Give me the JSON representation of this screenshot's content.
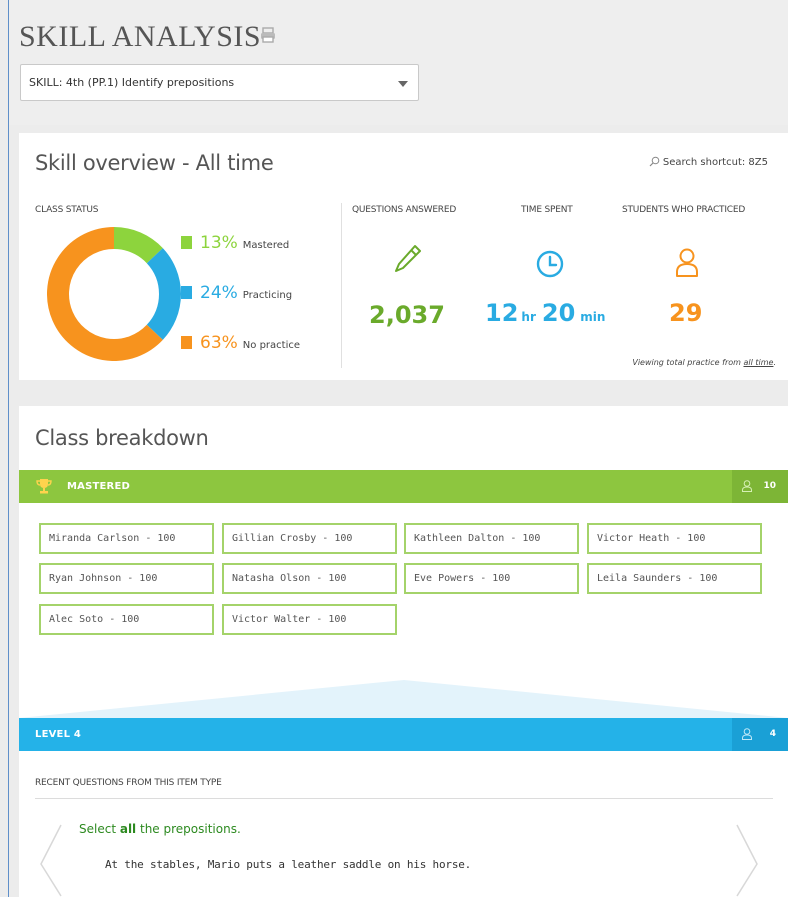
{
  "header": {
    "title": "SKILL ANALYSIS",
    "print_icon": "printer-icon",
    "skill_select_value": "SKILL: 4th (PP.1)  Identify prepositions"
  },
  "overview": {
    "title": "Skill overview - All time",
    "search_shortcut": "Search shortcut: 8Z5",
    "class_status_label": "CLASS STATUS",
    "status": [
      {
        "pct": "13%",
        "label": "Mastered",
        "value": 13,
        "color": "#8dd43d"
      },
      {
        "pct": "24%",
        "label": "Practicing",
        "value": 24,
        "color": "#29abe2"
      },
      {
        "pct": "63%",
        "label": "No practice",
        "value": 63,
        "color": "#f7931e"
      }
    ],
    "questions_label": "QUESTIONS ANSWERED",
    "questions_value": "2,037",
    "questions_color": "#6aaa2b",
    "time_label": "TIME SPENT",
    "time_hr": "12",
    "time_hr_unit": "hr",
    "time_min": "20",
    "time_min_unit": "min",
    "time_color": "#29abe2",
    "students_label": "STUDENTS WHO PRACTICED",
    "students_value": "29",
    "students_color": "#f7931e",
    "viewing_prefix": "Viewing total practice from ",
    "viewing_link": "all time",
    "viewing_suffix": "."
  },
  "breakdown": {
    "title": "Class breakdown",
    "mastered_label": "MASTERED",
    "mastered_count": "10",
    "students": [
      "Miranda Carlson - 100",
      "Gillian Crosby - 100",
      "Kathleen Dalton - 100",
      "Victor Heath - 100",
      "Ryan Johnson - 100",
      "Natasha Olson - 100",
      "Eve Powers - 100",
      "Leila Saunders - 100",
      "Alec Soto - 100",
      "Victor Walter - 100"
    ],
    "level_label": "LEVEL 4",
    "level_count": "4",
    "recent_label": "RECENT QUESTIONS FROM THIS ITEM TYPE",
    "question_prefix": "Select ",
    "question_bold": "all",
    "question_suffix": " the prepositions.",
    "question_sentence": "At the stables, Mario puts a leather saddle on his horse."
  }
}
